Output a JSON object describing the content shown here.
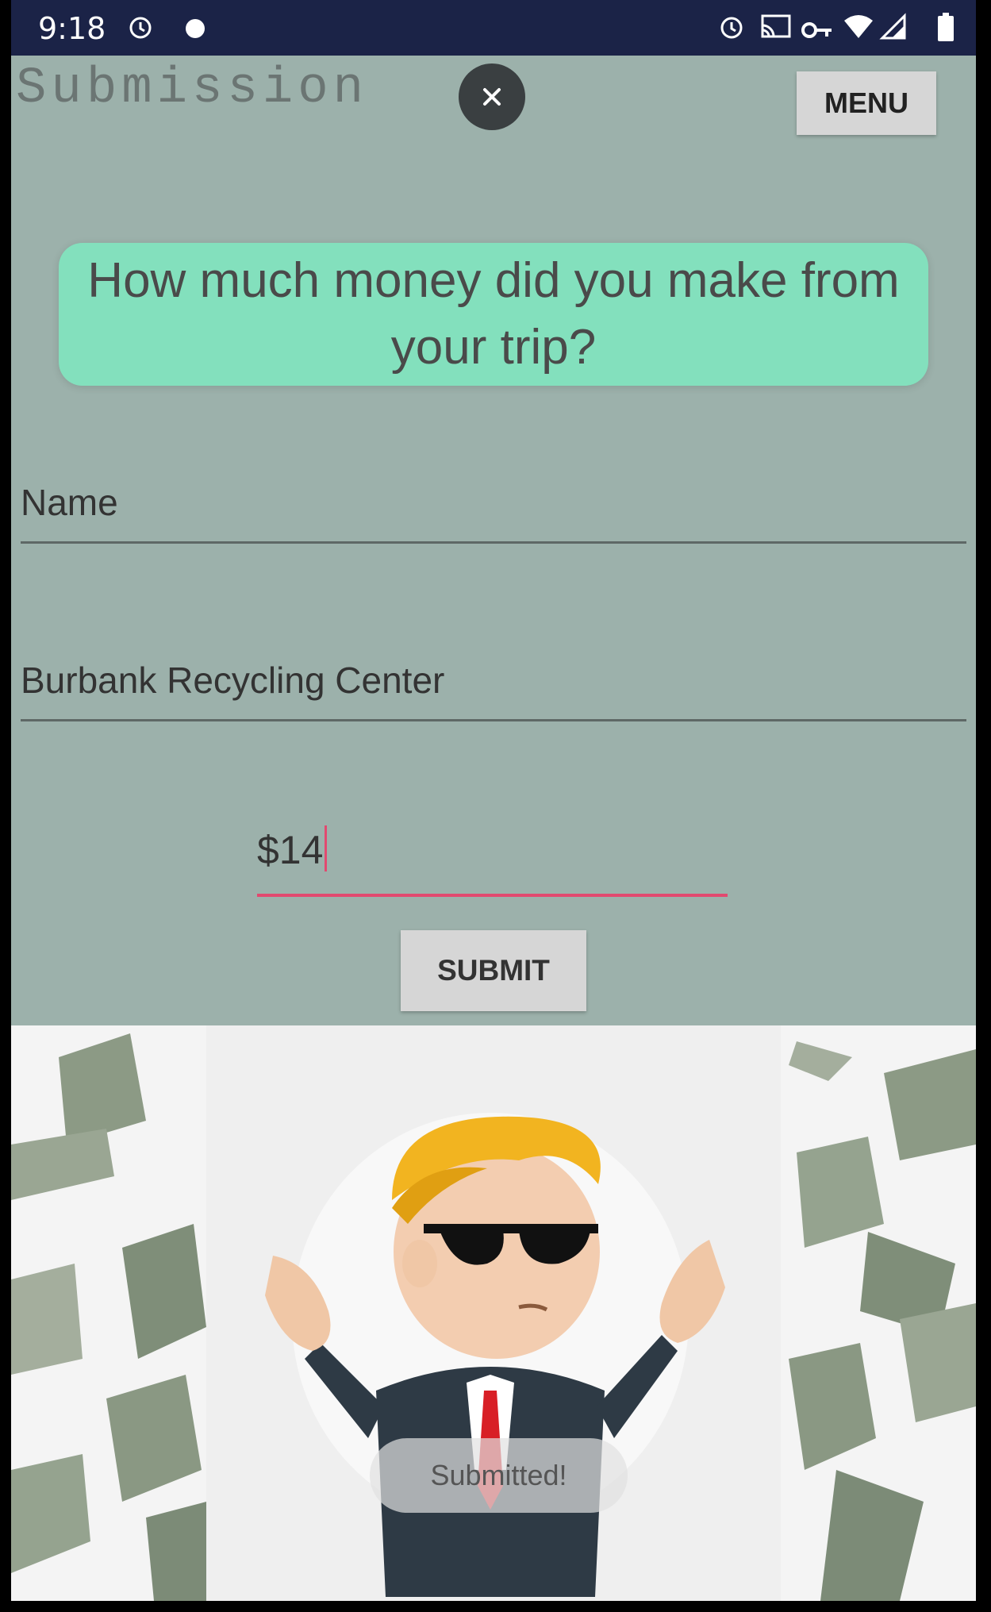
{
  "status_bar": {
    "time": "9:18",
    "icons": [
      "alarm-icon",
      "notification-dot-icon",
      "alarm-icon",
      "cast-icon",
      "vpn-key-icon",
      "wifi-icon",
      "signal-icon",
      "battery-icon"
    ]
  },
  "app_bar": {
    "title": "Submission",
    "close_icon": "close-icon",
    "menu_label": "MENU"
  },
  "question": "How much money did you make from your trip?",
  "form": {
    "name_placeholder": "Name",
    "location_value": "Burbank Recycling Center",
    "amount_value": "$14",
    "submit_label": "SUBMIT"
  },
  "image_area": {
    "illustration": "money-rain-mascot-image"
  },
  "toast": "Submitted!",
  "colors": {
    "background": "#9cb1ab",
    "status_bar": "#1b2347",
    "question_bubble": "#83e0bd",
    "accent_underline": "#e2496f",
    "button": "#d6d6d6"
  }
}
